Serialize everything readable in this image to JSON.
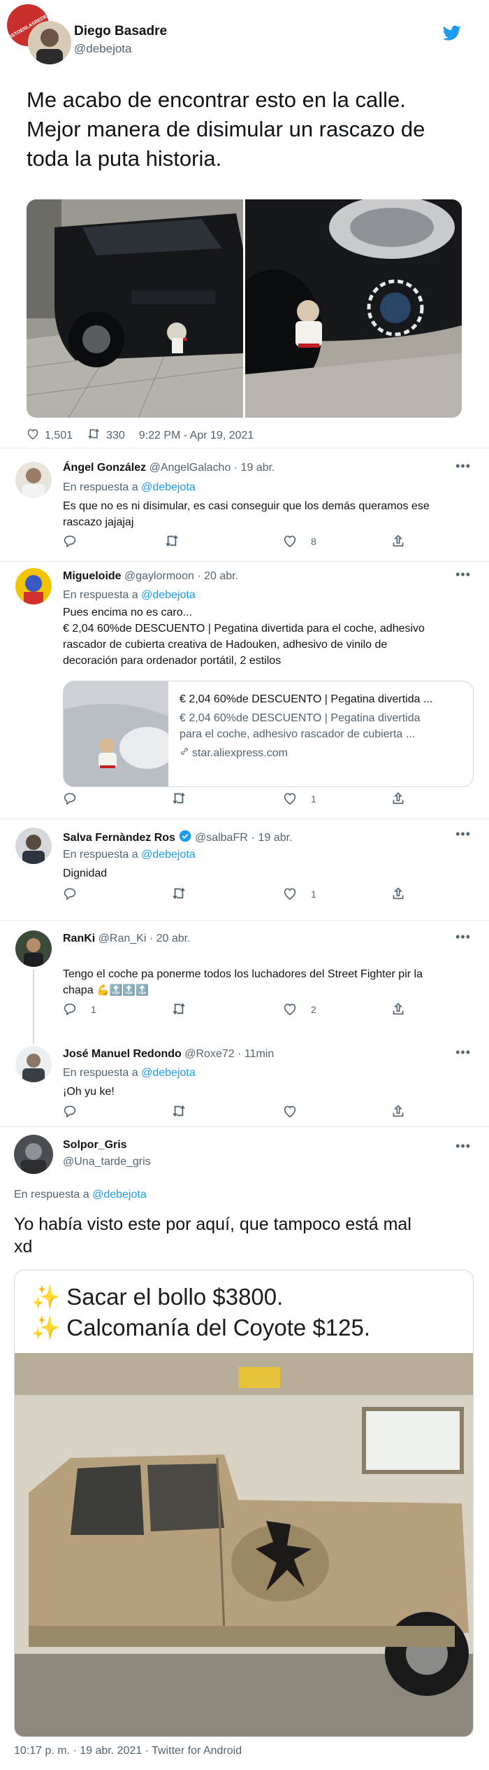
{
  "watermark": "VISTOENLASREDES.COM",
  "main_tweet": {
    "name": "Diego Basadre",
    "handle": "@debejota",
    "text_lines": [
      "Me acabo de encontrar esto en la calle.",
      "Mejor manera de disimular un rascazo de",
      "toda la puta historia."
    ],
    "likes": "1,501",
    "retweets": "330",
    "timestamp": "9:22 PM - Apr 19, 2021"
  },
  "replies": [
    {
      "name": "Ángel González",
      "handle": "@AngelGalacho",
      "date": "· 19 abr.",
      "reply_to_prefix": "En respuesta a",
      "reply_to": "@debejota",
      "text_lines": [
        "Es que no es ni disimular, es casi conseguir que los demás queramos ese",
        "rascazo jajajaj"
      ],
      "likes": "8"
    },
    {
      "name": "Migueloide",
      "handle": "@gaylormoon",
      "date": "· 20 abr.",
      "reply_to_prefix": "En respuesta a",
      "reply_to": "@debejota",
      "text_lines": [
        "Pues encima no es caro...",
        "€ 2,04  60%de DESCUENTO | Pegatina divertida para el coche, adhesivo",
        "rascador de cubierta creativa de Hadouken, adhesivo de vinilo de",
        "decoración para ordenador portátil, 2 estilos"
      ],
      "card": {
        "title": "€ 2,04 60%de DESCUENTO | Pegatina divertida ...",
        "desc_lines": [
          "€ 2,04 60%de DESCUENTO | Pegatina divertida",
          "para el coche, adhesivo rascador de cubierta ..."
        ],
        "domain": "star.aliexpress.com"
      },
      "likes": "1"
    },
    {
      "name": "Salva Fernàndez Ros",
      "handle": "@salbaFR",
      "date": "· 19 abr.",
      "reply_to_prefix": "En respuesta a",
      "reply_to": "@debejota",
      "text_lines": [
        "Dignidad"
      ],
      "likes": "1"
    },
    {
      "name": "RanKi",
      "handle": "@Ran_Ki",
      "date": "· 20 abr.",
      "text_lines": [
        "Tengo el coche pa ponerme todos los luchadores del Street Fighter pir la",
        "chapa"
      ],
      "emoji_tail": "💪🔝🔝🔝",
      "replies_count": "1",
      "likes": "2"
    },
    {
      "name": "José Manuel Redondo",
      "handle": "@Roxe72",
      "date": "· 11min",
      "reply_to_prefix": "En respuesta a",
      "reply_to": "@debejota",
      "text_lines": [
        "¡Oh yu ke!"
      ]
    }
  ],
  "final_tweet": {
    "name": "Solpor_Gris",
    "handle": "@Una_tarde_gris",
    "reply_to_prefix": "En respuesta a",
    "reply_to": "@debejota",
    "text_lines": [
      "Yo había visto este por aquí, que tampoco está mal",
      "xd"
    ],
    "image_caption_lines": [
      "✨ Sacar el bollo $3800.",
      "✨ Calcomanía del Coyote $125."
    ],
    "footer": "10:17 p. m. · 19 abr. 2021 · Twitter for Android"
  },
  "colors": {
    "accent": "#1d9bf0",
    "secondary_text": "#536471",
    "divider": "#e6ecf0",
    "verified": "#1d9bf0"
  }
}
